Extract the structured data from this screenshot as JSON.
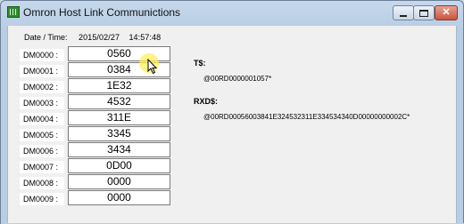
{
  "window": {
    "title": "Omron Host Link Communictions",
    "controls": {
      "minimize": "minimize",
      "maximize": "maximize",
      "close": "close"
    },
    "icon": "app-grid-icon"
  },
  "datetime": {
    "label": "Date / Time:",
    "date": "2015/02/27",
    "time": "14:57:48"
  },
  "registers": [
    {
      "label": "DM0000 :",
      "value": "0560"
    },
    {
      "label": "DM0001 :",
      "value": "0384"
    },
    {
      "label": "DM0002 :",
      "value": "1E32"
    },
    {
      "label": "DM0003 :",
      "value": "4532"
    },
    {
      "label": "DM0004 :",
      "value": "311E"
    },
    {
      "label": "DM0005 :",
      "value": "3345"
    },
    {
      "label": "DM0006 :",
      "value": "3434"
    },
    {
      "label": "DM0007 :",
      "value": "0D00"
    },
    {
      "label": "DM0008 :",
      "value": "0000"
    },
    {
      "label": "DM0009 :",
      "value": "0000"
    }
  ],
  "tx": {
    "label": "T$:",
    "value": "@00RD0000001057*"
  },
  "rx": {
    "label": "RXD$:",
    "value": "@00RD00056003841E324532311E334534340D00000000002C*"
  },
  "cursor": {
    "icon": "mouse-pointer-icon",
    "highlight": "#fff05a"
  }
}
